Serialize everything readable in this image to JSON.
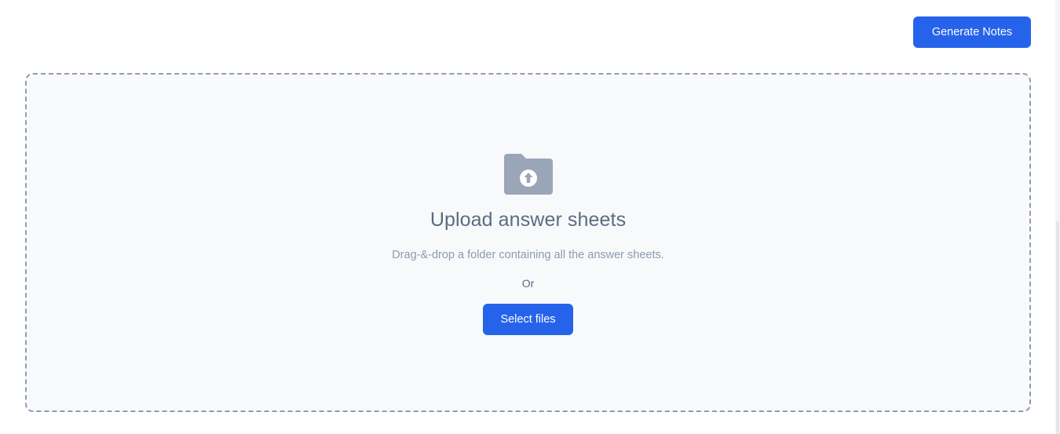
{
  "header": {
    "generate_label": "Generate Notes"
  },
  "upload": {
    "icon": "folder-upload-icon",
    "title": "Upload answer sheets",
    "description": "Drag-&-drop a folder containing all the answer sheets.",
    "or_label": "Or",
    "select_label": "Select files"
  },
  "colors": {
    "primary": "#2563eb",
    "dropzone_background": "#f8f9fb",
    "dropzone_border": "#8f9cb0",
    "icon": "#9aa5b8",
    "title_text": "#5b6b82",
    "muted_text": "#8e9ab0"
  }
}
